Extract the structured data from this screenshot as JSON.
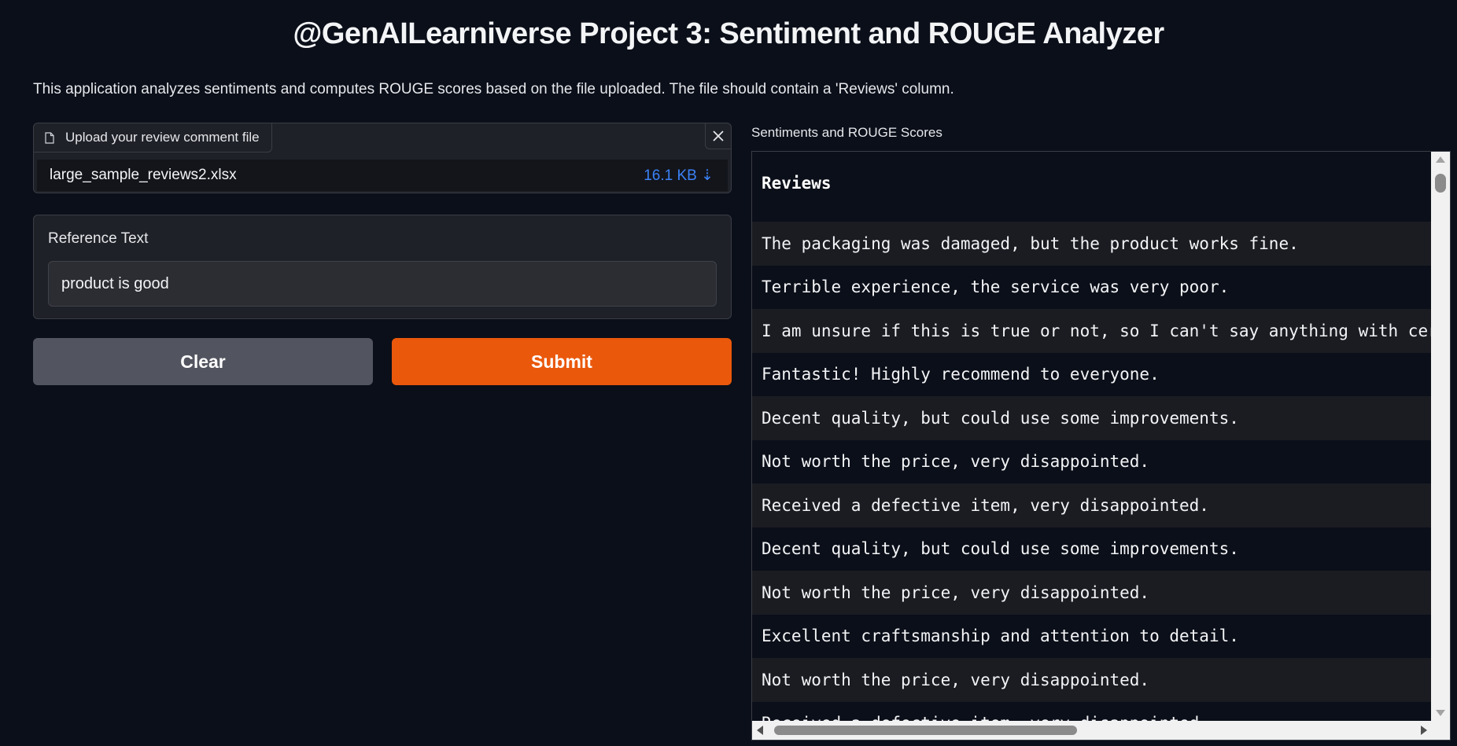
{
  "header": {
    "title": "@GenAILearniverse Project 3: Sentiment and ROUGE Analyzer",
    "description": "This application analyzes sentiments and computes ROUGE scores based on the file uploaded. The file should contain a 'Reviews' column."
  },
  "upload": {
    "label": "Upload your review comment file",
    "file_name": "large_sample_reviews2.xlsx",
    "file_size": "16.1 KB ⇣",
    "icons": [
      "document-icon",
      "close-icon"
    ]
  },
  "reference": {
    "label": "Reference Text",
    "value": "product is good"
  },
  "buttons": {
    "clear": "Clear",
    "submit": "Submit"
  },
  "output": {
    "label": "Sentiments and ROUGE Scores",
    "column_header": "Reviews",
    "rows": [
      "The packaging was damaged, but the product works fine.",
      "Terrible experience, the service was very poor.",
      "I am unsure if this is true or not, so I can't say anything with cer",
      "Fantastic! Highly recommend to everyone.",
      "Decent quality, but could use some improvements.",
      "Not worth the price, very disappointed.",
      "Received a defective item, very disappointed.",
      "Decent quality, but could use some improvements.",
      "Not worth the price, very disappointed.",
      "Excellent craftsmanship and attention to detail.",
      "Not worth the price, very disappointed.",
      "Received a defective item, very disappointed."
    ]
  },
  "colors": {
    "background": "#0b0f19",
    "submit": "#ea580c",
    "clear": "#52545f",
    "file_size_link": "#3b82f6"
  }
}
